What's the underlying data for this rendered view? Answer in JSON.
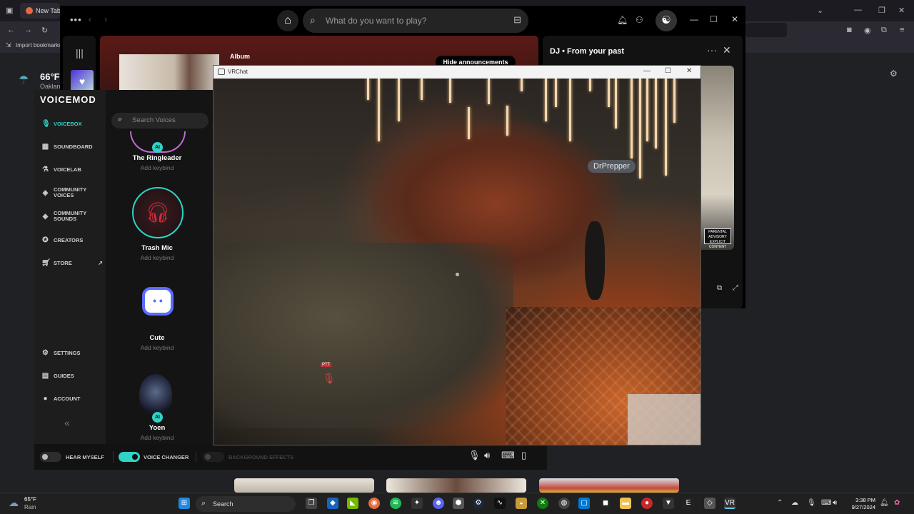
{
  "browser": {
    "tab_label": "New Tab",
    "bookmark_label": "Import bookmarks..."
  },
  "weather": {
    "temp": "66°F",
    "city": "Oakland"
  },
  "spotify": {
    "search_placeholder": "What do you want to play?",
    "album_label": "Album",
    "hide_button": "Hide announcements",
    "dj_title": "DJ • From your past",
    "advisory": "PARENTAL ADVISORY EXPLICIT CONTENT"
  },
  "voicemod": {
    "logo": "VOICEMOD",
    "nav": [
      {
        "label": "VOICEBOX",
        "icon": "microphone-icon",
        "active": true
      },
      {
        "label": "SOUNDBOARD",
        "icon": "soundboard-icon"
      },
      {
        "label": "VOICELAB",
        "icon": "flask-icon"
      },
      {
        "label": "COMMUNITY VOICES",
        "icon": "community-voices-icon"
      },
      {
        "label": "COMMUNITY SOUNDS",
        "icon": "community-sounds-icon"
      },
      {
        "label": "CREATORS",
        "icon": "creators-icon"
      },
      {
        "label": "STORE",
        "icon": "cart-icon"
      },
      {
        "label": "SETTINGS",
        "icon": "gear-icon"
      },
      {
        "label": "GUIDES",
        "icon": "document-icon"
      },
      {
        "label": "ACCOUNT",
        "icon": "user-icon"
      }
    ],
    "search_placeholder": "Search Voices",
    "voices": [
      {
        "name": "The Ringleader",
        "keybind": "Add keybind",
        "ai": true
      },
      {
        "name": "Trash Mic",
        "keybind": "Add keybind"
      },
      {
        "name": "Cute",
        "keybind": "Add keybind"
      },
      {
        "name": "Yoen",
        "keybind": "Add keybind",
        "ai": true
      }
    ],
    "ai_badge": "AI",
    "bottom": {
      "hear_myself": "HEAR MYSELF",
      "voice_changer": "VOICE CHANGER",
      "background_effects": "BACKGROUND EFFECTS",
      "voice_changer_on": true,
      "hear_myself_on": false
    }
  },
  "vrchat": {
    "title": "VRChat",
    "nameplate": "DrPrepper",
    "ptt": "PTT"
  },
  "taskbar": {
    "temp": "65°F",
    "condition": "Rain",
    "search": "Search",
    "time": "3:38 PM",
    "date": "9/27/2024"
  }
}
